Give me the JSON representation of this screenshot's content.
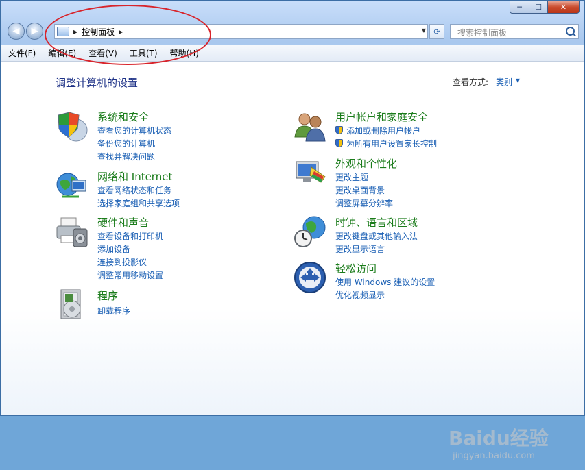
{
  "window": {
    "caption": {
      "minimize": "─",
      "maximize": "☐",
      "close": "✕"
    }
  },
  "navbar": {
    "back_glyph": "◀",
    "forward_glyph": "▶",
    "address": {
      "breadcrumb": "控制面板",
      "arrow_glyph": "▶",
      "dropdown_glyph": "▼"
    },
    "refresh_glyph": "⟳",
    "search_placeholder": "搜索控制面板"
  },
  "menubar": {
    "items": [
      "文件(F)",
      "编辑(E)",
      "查看(V)",
      "工具(T)",
      "帮助(H)"
    ]
  },
  "main": {
    "title": "调整计算机的设置",
    "view_by_label": "查看方式:",
    "view_by_value": "类别",
    "view_by_arrow": "▼",
    "categories": [
      {
        "title": "系统和安全",
        "icon": "shield-computer-icon",
        "links": [
          "查看您的计算机状态",
          "备份您的计算机",
          "查找并解决问题"
        ]
      },
      {
        "title": "网络和 Internet",
        "icon": "network-globe-icon",
        "links": [
          "查看网络状态和任务",
          "选择家庭组和共享选项"
        ]
      },
      {
        "title": "硬件和声音",
        "icon": "printer-speaker-icon",
        "links": [
          "查看设备和打印机",
          "添加设备",
          "连接到投影仪",
          "调整常用移动设置"
        ]
      },
      {
        "title": "程序",
        "icon": "programs-box-icon",
        "links": [
          "卸载程序"
        ]
      },
      {
        "title": "用户帐户和家庭安全",
        "icon": "users-icon",
        "links": [
          "添加或删除用户帐户",
          "为所有用户设置家长控制"
        ]
      },
      {
        "title": "外观和个性化",
        "icon": "monitor-palette-icon",
        "links": [
          "更改主题",
          "更改桌面背景",
          "调整屏幕分辨率"
        ]
      },
      {
        "title": "时钟、语言和区域",
        "icon": "clock-globe-icon",
        "links": [
          "更改键盘或其他输入法",
          "更改显示语言"
        ]
      },
      {
        "title": "轻松访问",
        "icon": "ease-of-access-icon",
        "links": [
          "使用 Windows 建议的设置",
          "优化视频显示"
        ]
      }
    ]
  },
  "watermark": {
    "logo_text": "Baidu经验",
    "url": "jingyan.baidu.com"
  },
  "colors": {
    "title_blue": "#1e3287",
    "category_green": "#1b7c1b",
    "link_blue": "#1a5fb4",
    "annotation_red": "#d8242b"
  }
}
